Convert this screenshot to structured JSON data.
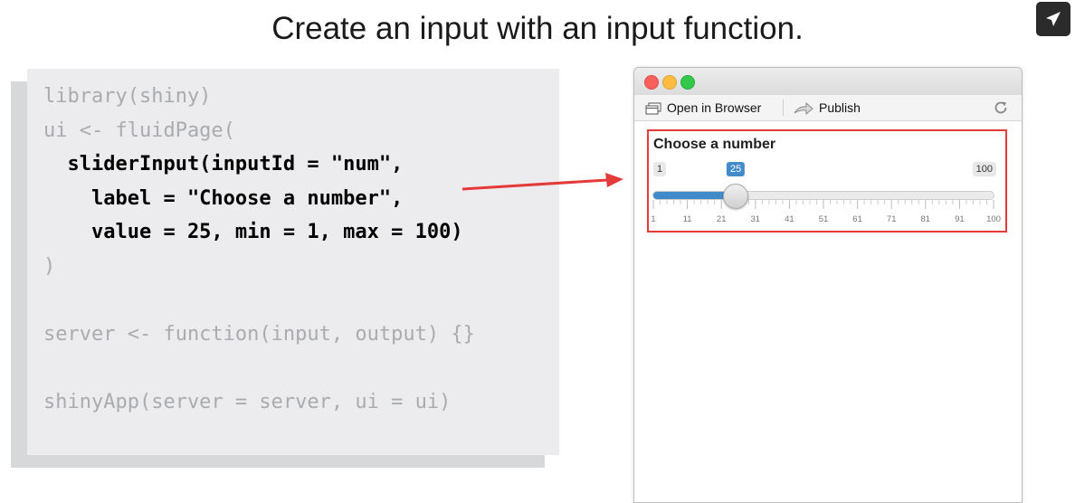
{
  "slide": {
    "title": "Create an input with an input function.",
    "send_icon": "paper-plane-icon"
  },
  "code": {
    "lines": [
      {
        "text": "library(shiny)",
        "highlight": false
      },
      {
        "text": "ui <- fluidPage(",
        "highlight": false
      },
      {
        "text": "  sliderInput(inputId = \"num\",",
        "highlight": true
      },
      {
        "text": "    label = \"Choose a number\",",
        "highlight": true
      },
      {
        "text": "    value = 25, min = 1, max = 100)",
        "highlight": true
      },
      {
        "text": ")",
        "highlight": false
      },
      {
        "text": "",
        "highlight": false
      },
      {
        "text": "server <- function(input, output) {}",
        "highlight": false
      },
      {
        "text": "",
        "highlight": false
      },
      {
        "text": "shinyApp(server = server, ui = ui)",
        "highlight": false
      }
    ]
  },
  "window": {
    "toolbar": {
      "open_label": "Open in Browser",
      "publish_label": "Publish"
    },
    "slider": {
      "label": "Choose a number",
      "min": 1,
      "max": 100,
      "value": 25,
      "min_text": "1",
      "max_text": "100",
      "value_text": "25",
      "grid_labels": [
        "1",
        "11",
        "21",
        "31",
        "41",
        "51",
        "61",
        "71",
        "81",
        "91",
        "100"
      ]
    }
  },
  "colors": {
    "accent": "#428bca",
    "highlight_box": "#e53a3a",
    "arrow": "#e53a3a"
  }
}
